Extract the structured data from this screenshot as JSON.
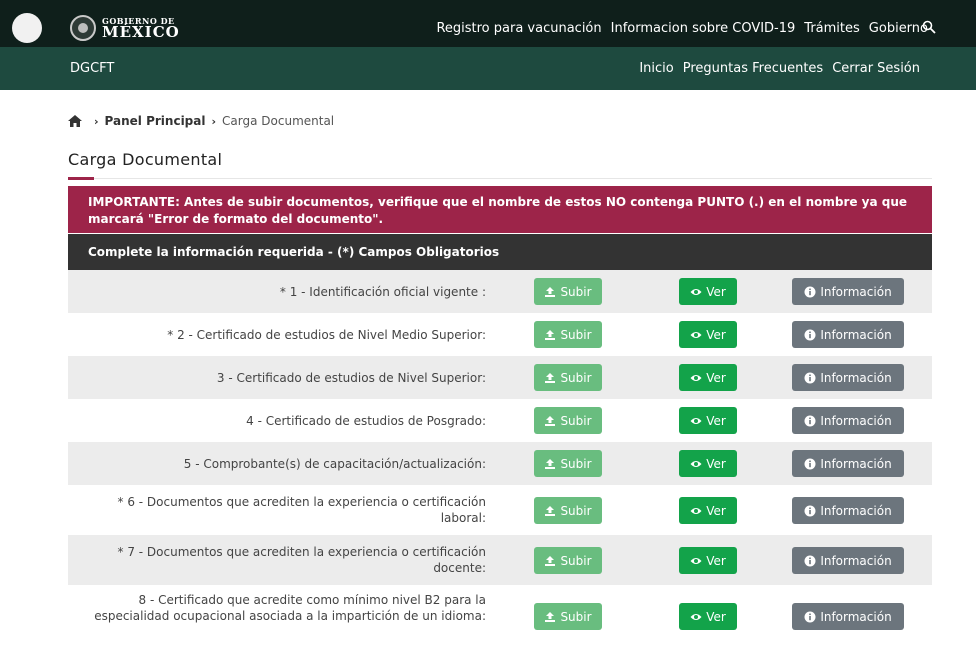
{
  "header": {
    "logo_small": "GOBIERNO DE",
    "logo_big": "MÉXICO",
    "links": [
      "Registro para vacunación",
      "Informacion sobre COVID-19",
      "Trámites",
      "Gobierno"
    ]
  },
  "subnav": {
    "title": "DGCFT",
    "links": [
      "Inicio",
      "Preguntas Frecuentes",
      "Cerrar Sesión"
    ]
  },
  "breadcrumb": {
    "panel": "Panel Principal",
    "current": "Carga Documental"
  },
  "page_title": "Carga Documental",
  "alert": "IMPORTANTE: Antes de subir documentos, verifique que el nombre de estos NO contenga PUNTO (.) en el nombre ya que marcará \"Error de formato del documento\".",
  "form_header": "Complete la información requerida - (*) Campos Obligatorios",
  "buttons": {
    "upload": "Subir",
    "view": "Ver",
    "info": "Información"
  },
  "documents": [
    {
      "label": "* 1 - Identificación oficial vigente :"
    },
    {
      "label": "* 2 - Certificado de estudios de Nivel Medio Superior:"
    },
    {
      "label": "3 - Certificado de estudios de Nivel Superior:"
    },
    {
      "label": "4 - Certificado de estudios de Posgrado:"
    },
    {
      "label": "5 - Comprobante(s) de capacitación/actualización:"
    },
    {
      "label": "* 6 - Documentos que acrediten la experiencia o certificación laboral:"
    },
    {
      "label": "* 7 - Documentos que acrediten la experiencia o certificación docente:"
    },
    {
      "label": "8 - Certificado que acredite como mínimo nivel B2 para la especialidad ocupacional asociada a la impartición de un idioma:"
    }
  ],
  "colors": {
    "header_dark": "#0f1f1b",
    "header_green": "#1e4a3f",
    "alert_red": "#9d2449",
    "upload_green": "#69bd7f",
    "view_green": "#13a34a",
    "info_gray": "#6c757d"
  }
}
